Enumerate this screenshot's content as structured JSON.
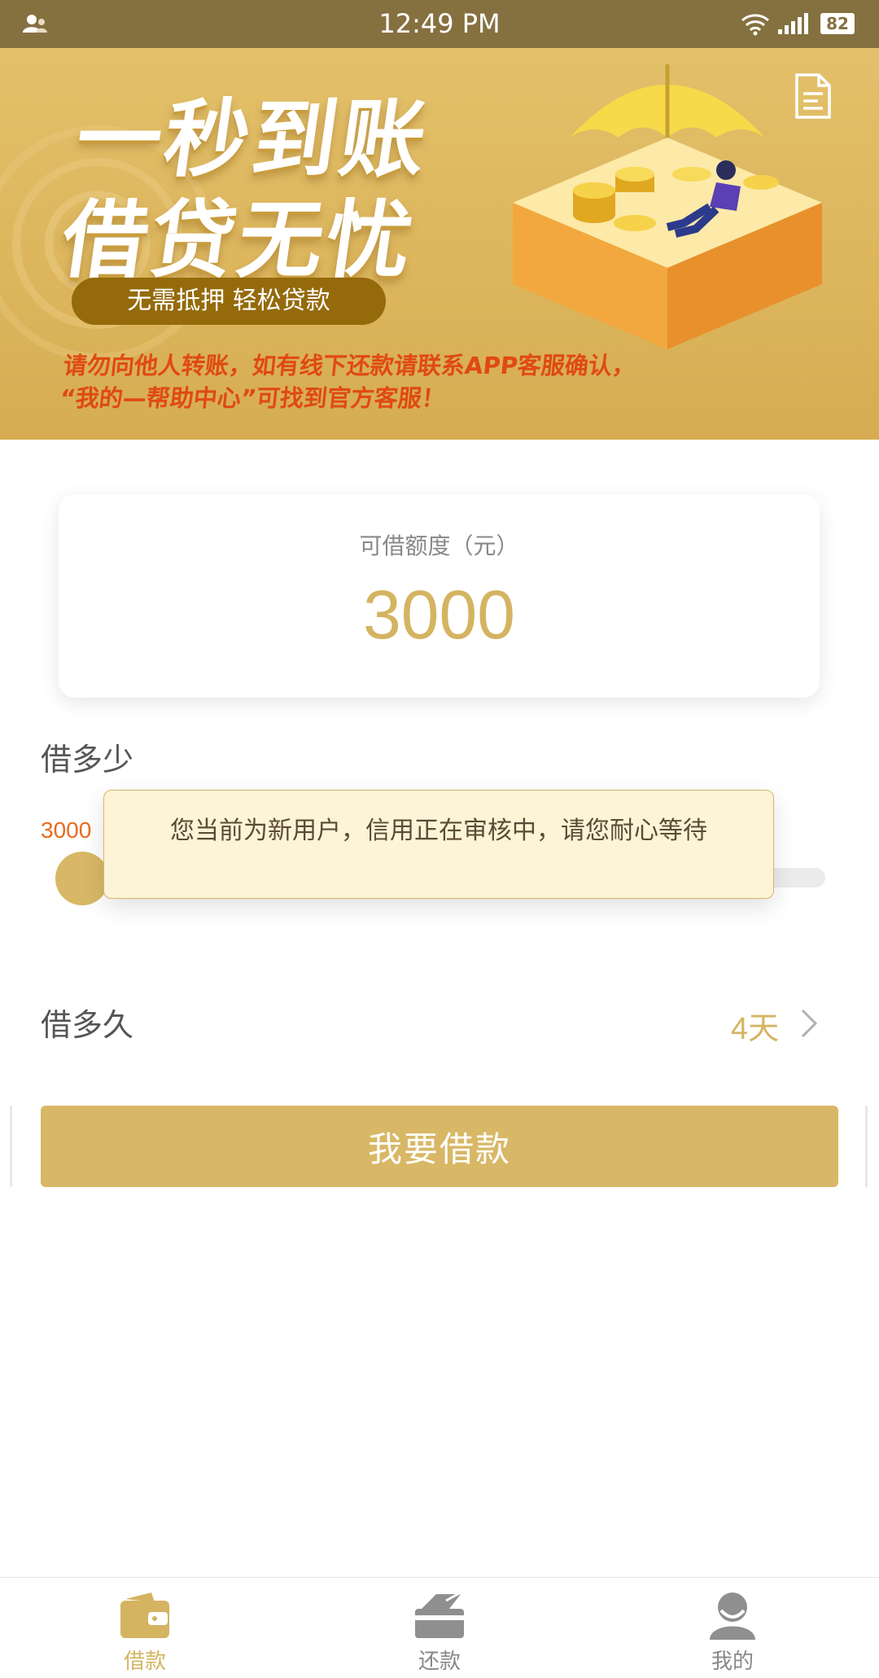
{
  "status_bar": {
    "time": "12:49 PM",
    "battery": "82"
  },
  "banner": {
    "slogan_line1": "一秒到账",
    "slogan_line2": "借贷无忧",
    "pill_text": "无需抵押  轻松贷款",
    "notice_line1": "请勿向他人转账，如有线下还款请联系APP客服确认，",
    "notice_line2": "“我的—帮助中心”可找到官方客服！"
  },
  "credit_card": {
    "label": "可借额度（元）",
    "value": "3000"
  },
  "borrow_amount": {
    "title": "借多少",
    "min_label": "3000"
  },
  "toast": {
    "message": "您当前为新用户，信用正在审核中，请您耐心等待"
  },
  "borrow_duration": {
    "title": "借多久",
    "value": "4天"
  },
  "submit": {
    "label": "我要借款"
  },
  "tabs": [
    {
      "label": "借款",
      "icon": "wallet-icon",
      "active": true
    },
    {
      "label": "还款",
      "icon": "card-return-icon",
      "active": false
    },
    {
      "label": "我的",
      "icon": "user-icon",
      "active": false
    }
  ],
  "colors": {
    "accent": "#d8b866",
    "status_bar": "#857040",
    "notice": "#e04a10",
    "tab_active": "#d4b461",
    "tab_inactive": "#888888"
  }
}
